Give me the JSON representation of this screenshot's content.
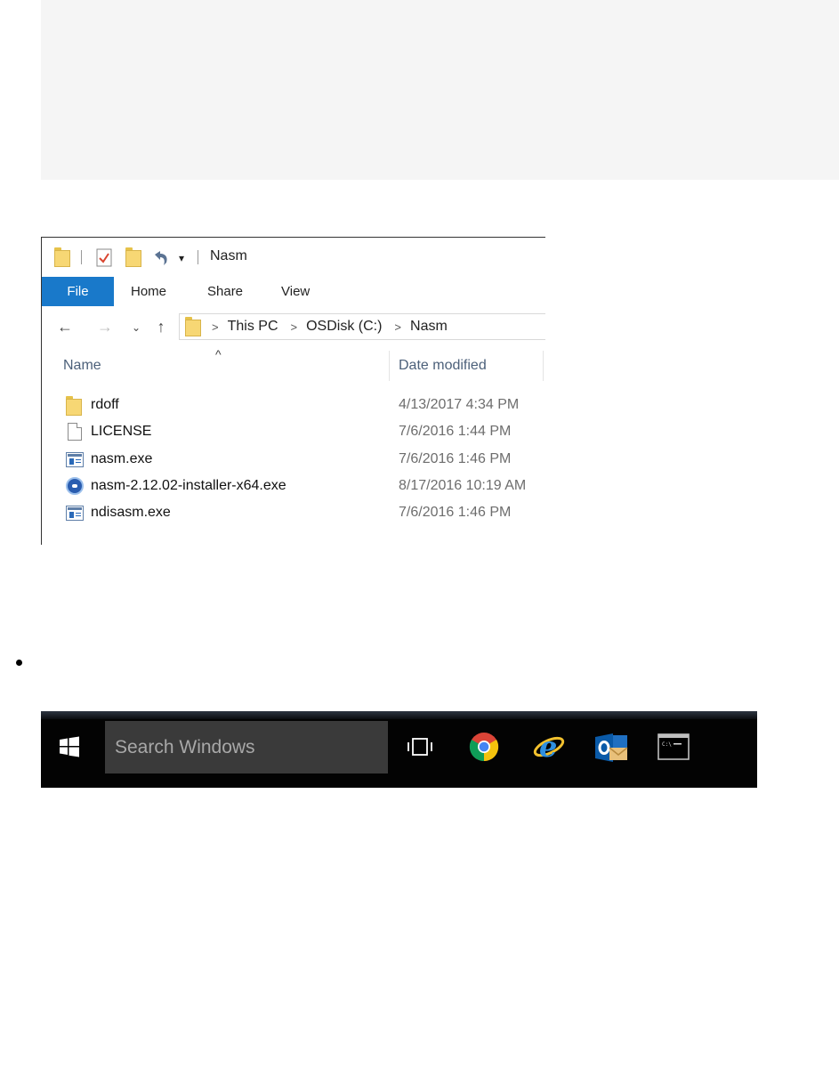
{
  "explorer": {
    "title": "Nasm",
    "ribbon_tabs": [
      "File",
      "Home",
      "Share",
      "View"
    ],
    "breadcrumb": [
      "This PC",
      "OSDisk (C:)",
      "Nasm"
    ],
    "columns": {
      "name": "Name",
      "date": "Date modified"
    },
    "files": [
      {
        "name": "rdoff",
        "date": "4/13/2017 4:34 PM",
        "icon": "folder-icon"
      },
      {
        "name": "LICENSE",
        "date": "7/6/2016 1:44 PM",
        "icon": "document-icon"
      },
      {
        "name": "nasm.exe",
        "date": "7/6/2016 1:46 PM",
        "icon": "exe-icon"
      },
      {
        "name": "nasm-2.12.02-installer-x64.exe",
        "date": "8/17/2016 10:19 AM",
        "icon": "installer-icon"
      },
      {
        "name": "ndisasm.exe",
        "date": "7/6/2016 1:46 PM",
        "icon": "exe-icon"
      }
    ]
  },
  "taskbar": {
    "search_placeholder": "Search Windows",
    "pinned_apps": [
      "task-view",
      "chrome",
      "internet-explorer",
      "outlook",
      "command-prompt"
    ]
  },
  "colors": {
    "file_tab": "#1979ca",
    "taskbar": "#030303",
    "search_box": "#3a3a3a"
  }
}
